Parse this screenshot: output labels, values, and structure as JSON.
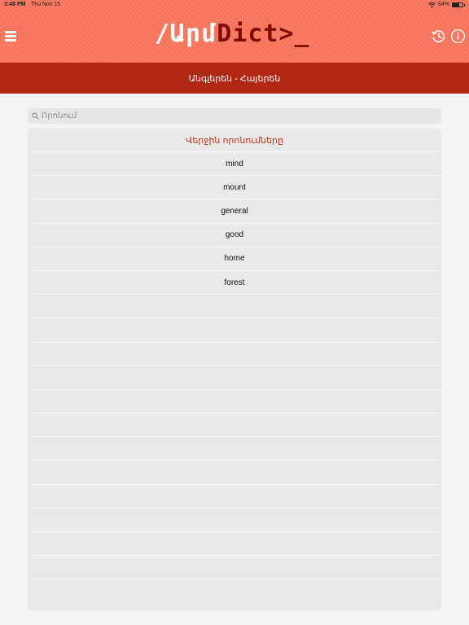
{
  "status_bar": {
    "time": "3:48 PM",
    "date": "Thu Nov 15",
    "battery_text": "64%",
    "battery_level": 0.64
  },
  "header": {
    "logo_part1": "/Արմ",
    "logo_part2": "Dict>_",
    "background_color": "#f8745a",
    "logo_accent_color": "#7e0d08"
  },
  "language_bar": {
    "label": "Անգլերեն - Հայերեն",
    "background_color": "#b02714"
  },
  "search": {
    "placeholder": "Որոնում",
    "value": ""
  },
  "recent": {
    "title": "Վերջին որոնումները",
    "title_color": "#c0311f",
    "items": [
      "mind",
      "mount",
      "general",
      "good",
      "home",
      "forest",
      "",
      "",
      "",
      "",
      "",
      "",
      "",
      "",
      "",
      "",
      "",
      "",
      ""
    ]
  }
}
